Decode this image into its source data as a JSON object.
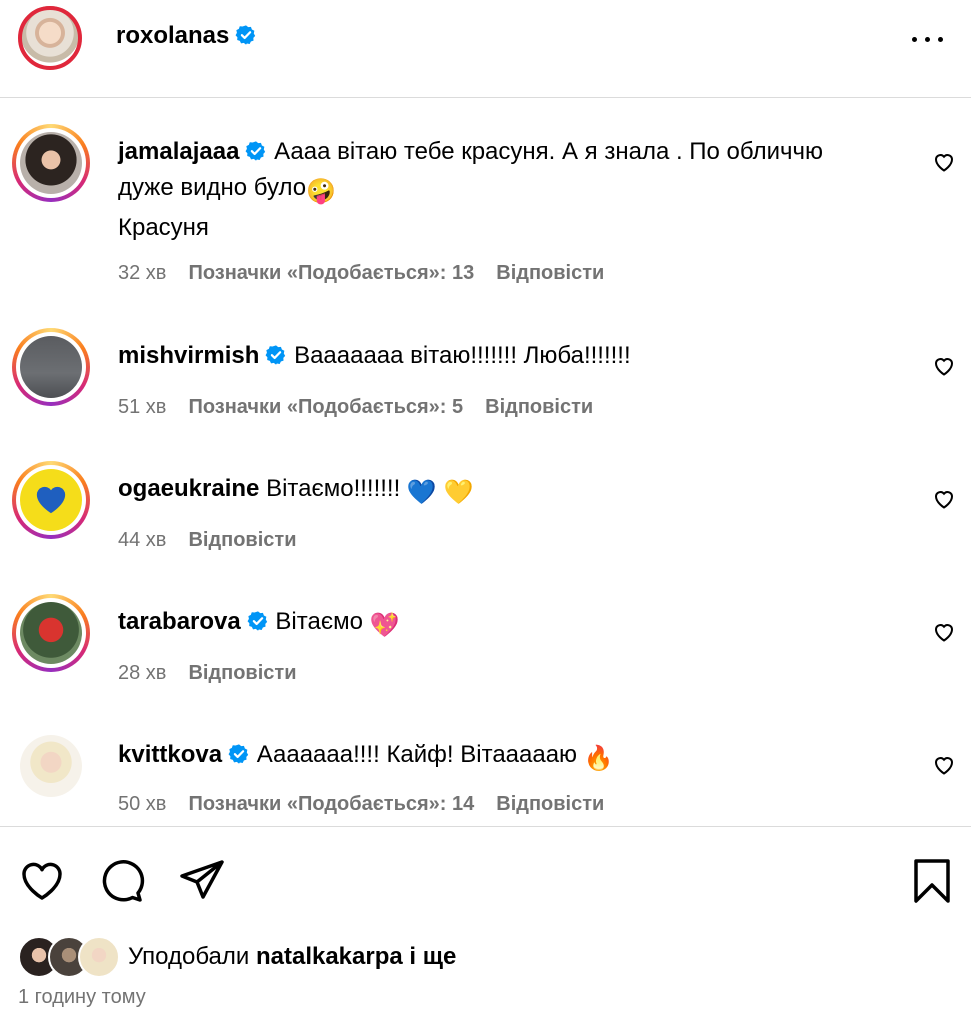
{
  "header": {
    "username": "roxolanas",
    "more_label": "..."
  },
  "comments": [
    {
      "username": "jamalajaaa",
      "verified": true,
      "text": "Аааа вітаю тебе красуня. А я знала . По обличчю дуже видно було",
      "emoji": "🤪",
      "text2": "Красуня",
      "time": "32 хв",
      "likes": "Позначки «Подобається»: 13",
      "reply": "Відповісти"
    },
    {
      "username": "mishvirmish",
      "verified": true,
      "text": "Вааааааа вітаю!!!!!!! Люба!!!!!!!",
      "time": "51 хв",
      "likes": "Позначки «Подобається»: 5",
      "reply": "Відповісти"
    },
    {
      "username": "ogaeukraine",
      "verified": false,
      "text": "Вітаємо!!!!!!!",
      "emoji": "💙 💛",
      "time": "44 хв",
      "reply": "Відповісти"
    },
    {
      "username": "tarabarova",
      "verified": true,
      "text": "Вітаємо",
      "emoji": "💖",
      "time": "28 хв",
      "reply": "Відповісти"
    },
    {
      "username": "kvittkova",
      "verified": true,
      "text": "Ааааааа!!!! Кайф! Вітаааааю",
      "emoji": "🔥",
      "time": "50 хв",
      "likes": "Позначки «Подобається»: 14",
      "reply": "Відповісти"
    }
  ],
  "likes_summary": {
    "prefix": "Уподобали",
    "user": "natalkakarpa",
    "suffix": "і ще"
  },
  "post_time": "1 годину тому",
  "colors": {
    "verified": "#0095f6",
    "meta": "#737373",
    "divider": "#dbdbdb"
  },
  "icons": [
    "heart-icon",
    "comment-icon",
    "share-icon",
    "bookmark-icon",
    "more-icon",
    "verified-icon"
  ]
}
